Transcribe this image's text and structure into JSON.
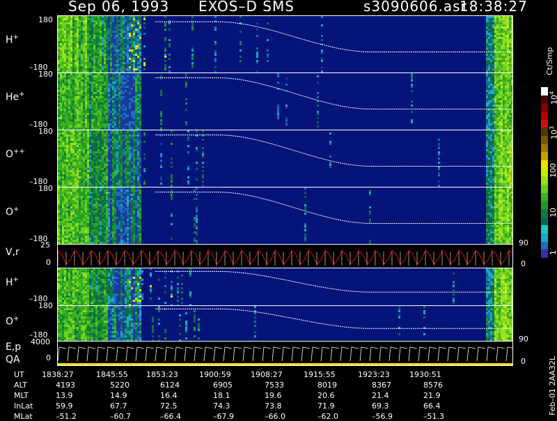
{
  "header": {
    "date": "Sep 06, 1993",
    "instrument": "EXOS–D SMS",
    "file": "s3090606.asr",
    "time": "18:38:27"
  },
  "panels": {
    "h1": {
      "label": "H",
      "sup": "+",
      "top": "180",
      "bottom": "–180"
    },
    "he": {
      "label": "He",
      "sup": "+",
      "top": "180",
      "bottom": "–180"
    },
    "o2": {
      "label": "O",
      "sup": "++",
      "top": "180",
      "bottom": "–180"
    },
    "o1": {
      "label": "O",
      "sup": "+",
      "top": "180",
      "bottom": "–180"
    },
    "vr": {
      "label": "V,r",
      "top": "25",
      "zero": "0",
      "right_top": "90",
      "right_bottom": "0"
    },
    "h2": {
      "label": "H",
      "sup": "+",
      "bottom": "–180"
    },
    "o3": {
      "label": "O",
      "sup": "+",
      "top": "180",
      "bottom": "–180",
      "right": "90"
    },
    "ep": {
      "label1": "E,p",
      "label2": "QA",
      "top": "4000",
      "zero": "0",
      "right": "0"
    }
  },
  "colorbar": {
    "unit": "Ct/Smp",
    "labels": {
      "e4": "10",
      "e4_sup": "4",
      "e3": "10",
      "e3_sup": "3",
      "l100": "100",
      "l10": "10",
      "l1": "1"
    },
    "colors": [
      "#3a2ea8",
      "#1a6fc0",
      "#1aa8c8",
      "#20c8c0",
      "#10605a",
      "#0f7a3a",
      "#1f9a2a",
      "#3fb020",
      "#6ad020",
      "#9ae020",
      "#c8e810",
      "#f0e000",
      "#c8a000",
      "#a07800",
      "#7a5800",
      "#503800",
      "#d01010",
      "#b00000",
      "#800000",
      "#4a0000",
      "#ffffff"
    ]
  },
  "table": {
    "rows": [
      {
        "name": "UT",
        "values": [
          "1838:27",
          "1845:55",
          "1853:23",
          "1900:59",
          "1908:27",
          "1915:55",
          "1923:23",
          "1930:51"
        ]
      },
      {
        "name": "ALT",
        "values": [
          "4193",
          "5220",
          "6124",
          "6905",
          "7533",
          "8019",
          "8367",
          "8576"
        ]
      },
      {
        "name": "MLT",
        "values": [
          "13.9",
          "14.9",
          "16.4",
          "18.1",
          "19.6",
          "20.6",
          "21.4",
          "21.9"
        ]
      },
      {
        "name": "InLat",
        "values": [
          "59.9",
          "67.7",
          "72.5",
          "74.3",
          "73.8",
          "71.9",
          "69.3",
          "66.4"
        ]
      },
      {
        "name": "MLat",
        "values": [
          "–51.2",
          "–60.7",
          "–66.4",
          "–67.9",
          "–66.0",
          "–62.0",
          "–56.9",
          "–51.3"
        ]
      }
    ]
  },
  "side_note": "Feb–01 2AA32L",
  "chart_data": {
    "type": "heatmap",
    "title": "Sep 06, 1993 EXOS–D SMS",
    "x": [
      "1838:27",
      "1845:55",
      "1853:23",
      "1900:59",
      "1908:27",
      "1915:55",
      "1923:23",
      "1930:51"
    ],
    "pitch_angle_range": [
      -180,
      180
    ],
    "color_scale": "log",
    "color_range": [
      1,
      10000
    ],
    "color_unit": "Ct/Smp",
    "series": [
      {
        "name": "H+",
        "ylim": [
          -180,
          180
        ]
      },
      {
        "name": "He+",
        "ylim": [
          -180,
          180
        ]
      },
      {
        "name": "O++",
        "ylim": [
          -180,
          180
        ]
      },
      {
        "name": "O+",
        "ylim": [
          -180,
          180
        ]
      },
      {
        "name": "V,r",
        "ylim": [
          0,
          25
        ],
        "right_ylim": [
          0,
          90
        ]
      },
      {
        "name": "H+",
        "ylim": [
          -180,
          180
        ]
      },
      {
        "name": "O+",
        "ylim": [
          -180,
          180
        ],
        "right_ylim": [
          0,
          90
        ]
      },
      {
        "name": "E,p",
        "ylim": [
          0,
          4000
        ]
      }
    ]
  }
}
